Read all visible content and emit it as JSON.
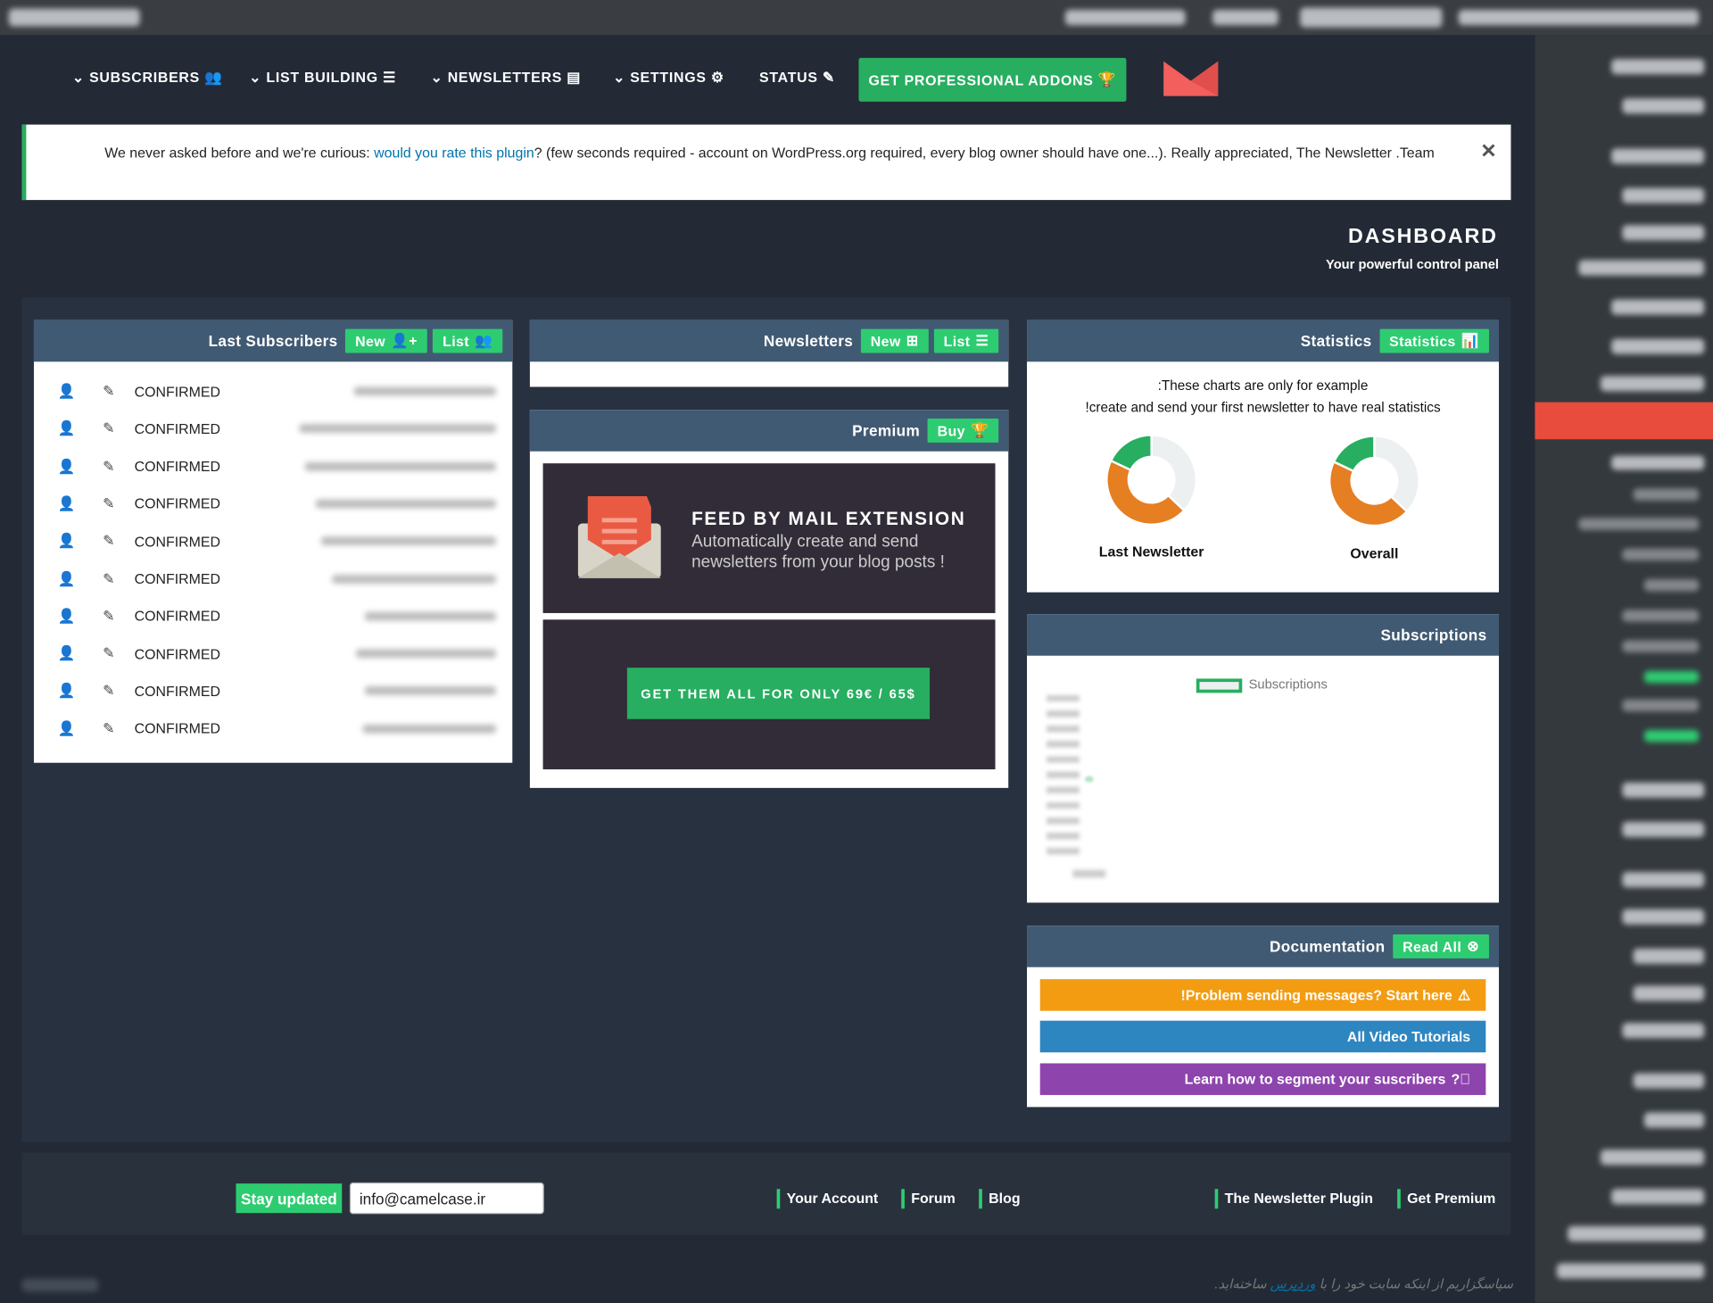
{
  "nav": {
    "items": [
      {
        "label": "SUBSCRIBERS",
        "icon": "users-icon"
      },
      {
        "label": "LIST BUILDING",
        "icon": "list-icon"
      },
      {
        "label": "NEWSLETTERS",
        "icon": "newspaper-icon"
      },
      {
        "label": "SETTINGS",
        "icon": "gear-icon"
      },
      {
        "label": "STATUS",
        "icon": "wrench-icon"
      }
    ],
    "pro_button": "GET PROFESSIONAL ADDONS"
  },
  "notice": {
    "text_before": "We never asked before and we're curious: ",
    "link": "would you rate this plugin",
    "text_after": "? (few seconds required - account on WordPress.org required, every blog owner should have one...). Really appreciated, The Newsletter .Team",
    "close": "✕"
  },
  "dashboard": {
    "title": "DASHBOARD",
    "subtitle": "Your powerful control panel"
  },
  "subscribers": {
    "title": "Last Subscribers",
    "new": "New",
    "list": "List",
    "rows": [
      "CONFIRMED",
      "CONFIRMED",
      "CONFIRMED",
      "CONFIRMED",
      "CONFIRMED",
      "CONFIRMED",
      "CONFIRMED",
      "CONFIRMED",
      "CONFIRMED",
      "CONFIRMED"
    ]
  },
  "newsletters": {
    "title": "Newsletters",
    "new": "New",
    "list": "List"
  },
  "premium": {
    "title": "Premium",
    "buy": "Buy",
    "feed_title": "FEED BY MAIL EXTENSION",
    "feed_desc_1": "Automatically create and send",
    "feed_desc_2": "newsletters from your blog posts !",
    "cta": "GET THEM ALL FOR ONLY 69€ / 65$"
  },
  "statistics": {
    "title": "Statistics",
    "button": "Statistics",
    "note_1": ":These charts are only for example",
    "note_2": "!create and send your first newsletter to have real statistics",
    "charts": [
      {
        "label": "Last Newsletter",
        "slices": [
          0.37,
          0.45,
          0.18
        ]
      },
      {
        "label": "Overall",
        "slices": [
          0.37,
          0.45,
          0.18
        ]
      }
    ],
    "colors": [
      "#ecf0f1",
      "#e67e22",
      "#27ae60"
    ]
  },
  "subscriptions": {
    "title": "Subscriptions",
    "legend": "Subscriptions"
  },
  "documentation": {
    "title": "Documentation",
    "read_all": "Read All",
    "links": [
      {
        "label": "!Problem sending messages? Start here",
        "color": "#f39c12"
      },
      {
        "label": "All Video Tutorials",
        "color": "#2e86c1"
      },
      {
        "label": "Learn how to segment your suscribers",
        "color": "#8e44ad"
      }
    ]
  },
  "footer": {
    "stay_updated": "Stay updated",
    "email": "info@camelcase.ir",
    "links": [
      "Your Account",
      "Forum",
      "Blog",
      "The Newsletter Plugin",
      "Get Premium"
    ]
  },
  "wp_footer": {
    "text_before": "سپاسگزاریم از اینکه سایت خود را با ",
    "link": "وردپرس",
    "text_after": " ساخته‌اید."
  }
}
